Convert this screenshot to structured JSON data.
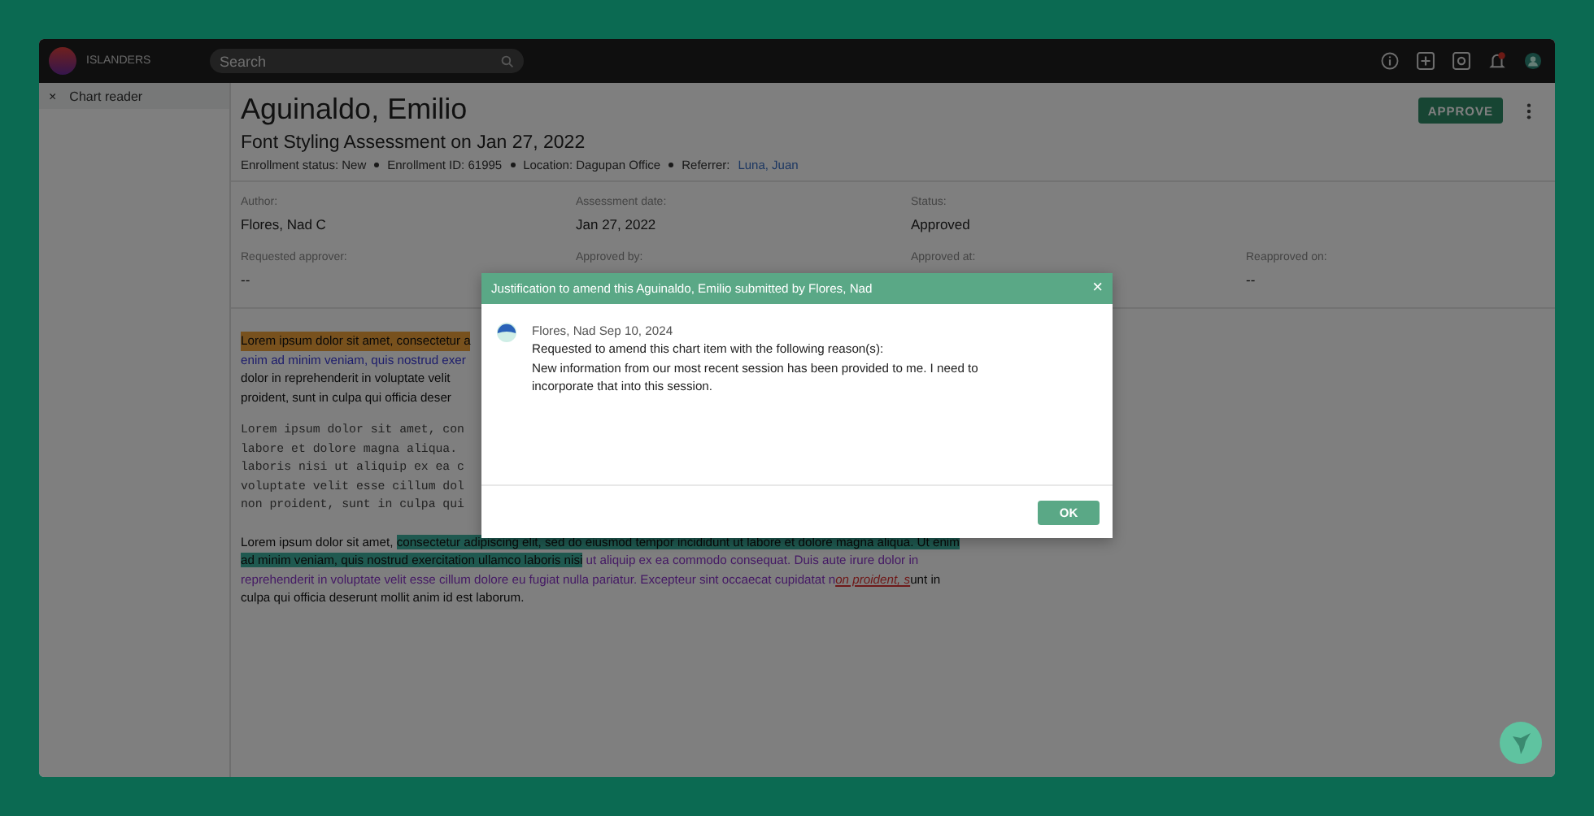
{
  "topbar": {
    "brand": "ISLANDERS",
    "search": {
      "placeholder": "Search"
    },
    "notifications": {
      "unread": true
    }
  },
  "sidebar": {
    "close": "×",
    "title": "Chart reader"
  },
  "record": {
    "name": "Aguinaldo, Emilio",
    "assessment": "Font Styling Assessment on Jan 27, 2022",
    "details": [
      "Enrollment status: New",
      "Enrollment ID: 61995",
      "Location: Dagupan Office"
    ],
    "referrer": {
      "label": "Referrer:",
      "link": "Luna, Juan"
    },
    "approve_button": "APPROVE"
  },
  "fields": [
    [
      {
        "label": "Author:",
        "value": "Flores, Nad C"
      },
      {
        "label": "Assessment date:",
        "value": "Jan 27, 2022"
      },
      {
        "label": "Status:",
        "value": "Approved"
      }
    ],
    [
      {
        "label": "Requested approver:",
        "value": "--"
      },
      {
        "label": "Approved by:"
      },
      {
        "label": "Approved at:"
      },
      {
        "label": "Reapproved on:",
        "value": "--"
      }
    ]
  ],
  "document": {
    "sans_lines": [
      {
        "text": "Lorem ipsum dolor sit amet, consectetur a",
        "kind": "marked"
      },
      {
        "text": "enim ad minim veniam, quis nostrud exer",
        "kind": "colored"
      },
      {
        "text": "dolor in reprehenderit in voluptate velit",
        "kind": "plain"
      },
      {
        "text": "proident, sunt in culpa qui officia deser",
        "kind": "plain"
      }
    ],
    "mono_lines": [
      "Lorem ipsum dolor sit amet, con",
      "labore et dolore magna aliqua.",
      "laboris nisi ut aliquip ex ea c",
      "voluptate velit esse cillum dol",
      "non proident, sunt in culpa qui"
    ],
    "styled_paragraph": [
      {
        "text": "Lorem ipsum dolor sit amet, ",
        "kind": "plain"
      },
      {
        "text": "consectetur adipiscing elit, sed do eiusmod tempor incididunt ut labore et dolore magna aliqua. Ut enim ad minim veniam, quis nostrud exercitation ullamco laboris nisi",
        "kind": "marked"
      },
      {
        "text": " ut aliquip ex ea commodo consequat. Duis aute irure dolor in reprehenderit in voluptate velit esse cillum dolore eu fugiat nulla pariatur. Excepteur sint occaecat cupidatat n",
        "kind": "colored"
      },
      {
        "text": "on proident, s",
        "kind": "link"
      },
      {
        "text": "unt in culpa qui officia deserunt mollit anim id est laborum.",
        "kind": "plain"
      }
    ]
  },
  "modal": {
    "title": "Justification to amend this Aguinaldo, Emilio submitted by Flores, Nad",
    "close": "×",
    "author_line": "Flores, Nad Sep 10, 2024",
    "request": "Requested to amend this chart item with the following reason(s):",
    "reason": "New information from our most recent session has been provided to me. I need to incorporate that into this session.",
    "ok_button": "OK"
  }
}
